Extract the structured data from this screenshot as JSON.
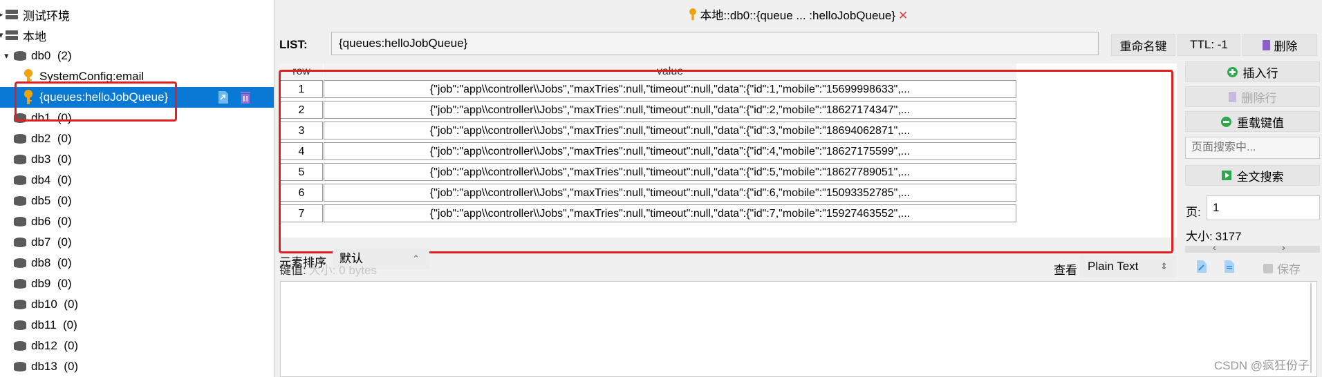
{
  "tree": {
    "items": [
      {
        "label": "测试环境",
        "type": "connection"
      },
      {
        "label": "本地",
        "type": "connection"
      },
      {
        "label": "db0",
        "count": "(2)",
        "type": "db"
      },
      {
        "label": "SystemConfig:email",
        "type": "key"
      },
      {
        "label": "{queues:helloJobQueue}",
        "type": "key"
      },
      {
        "label": "db1",
        "count": "(0)",
        "type": "db"
      },
      {
        "label": "db2",
        "count": "(0)",
        "type": "db"
      },
      {
        "label": "db3",
        "count": "(0)",
        "type": "db"
      },
      {
        "label": "db4",
        "count": "(0)",
        "type": "db"
      },
      {
        "label": "db5",
        "count": "(0)",
        "type": "db"
      },
      {
        "label": "db6",
        "count": "(0)",
        "type": "db"
      },
      {
        "label": "db7",
        "count": "(0)",
        "type": "db"
      },
      {
        "label": "db8",
        "count": "(0)",
        "type": "db"
      },
      {
        "label": "db9",
        "count": "(0)",
        "type": "db"
      },
      {
        "label": "db10",
        "count": "(0)",
        "type": "db"
      },
      {
        "label": "db11",
        "count": "(0)",
        "type": "db"
      },
      {
        "label": "db12",
        "count": "(0)",
        "type": "db"
      },
      {
        "label": "db13",
        "count": "(0)",
        "type": "db"
      }
    ]
  },
  "tab": {
    "title": "本地::db0::{queue ... :helloJobQueue}",
    "close": "✕"
  },
  "key": {
    "type_label": "LIST:",
    "name": "{queues:helloJobQueue}",
    "rename": "重命名键",
    "ttl": "TTL:  -1",
    "delete": "删除"
  },
  "table": {
    "columns": [
      "row",
      "value"
    ],
    "rows": [
      {
        "row": "1",
        "value": "{\"job\":\"app\\\\controller\\\\Jobs\",\"maxTries\":null,\"timeout\":null,\"data\":{\"id\":1,\"mobile\":\"15699998633\",..."
      },
      {
        "row": "2",
        "value": "{\"job\":\"app\\\\controller\\\\Jobs\",\"maxTries\":null,\"timeout\":null,\"data\":{\"id\":2,\"mobile\":\"18627174347\",..."
      },
      {
        "row": "3",
        "value": "{\"job\":\"app\\\\controller\\\\Jobs\",\"maxTries\":null,\"timeout\":null,\"data\":{\"id\":3,\"mobile\":\"18694062871\",..."
      },
      {
        "row": "4",
        "value": "{\"job\":\"app\\\\controller\\\\Jobs\",\"maxTries\":null,\"timeout\":null,\"data\":{\"id\":4,\"mobile\":\"18627175599\",..."
      },
      {
        "row": "5",
        "value": "{\"job\":\"app\\\\controller\\\\Jobs\",\"maxTries\":null,\"timeout\":null,\"data\":{\"id\":5,\"mobile\":\"18627789051\",..."
      },
      {
        "row": "6",
        "value": "{\"job\":\"app\\\\controller\\\\Jobs\",\"maxTries\":null,\"timeout\":null,\"data\":{\"id\":6,\"mobile\":\"15093352785\",..."
      },
      {
        "row": "7",
        "value": "{\"job\":\"app\\\\controller\\\\Jobs\",\"maxTries\":null,\"timeout\":null,\"data\":{\"id\":7,\"mobile\":\"15927463552\",..."
      }
    ]
  },
  "side": {
    "insert_row": "插入行",
    "delete_row": "删除行",
    "reload": "重载键值",
    "page_search_placeholder": "页面搜索中...",
    "full_search": "全文搜索",
    "page_label": "页:",
    "page_value": "1",
    "size_label": "大小:",
    "size_value": "3177"
  },
  "lower": {
    "sort_label": "元素排序",
    "sort_value": "默认",
    "keyval_label": "键值:",
    "keyval_size": "大小: 0 bytes",
    "view_label": "查看",
    "view_value": "Plain Text",
    "save": "保存"
  },
  "watermark": "CSDN @疯狂份子",
  "colors": {
    "selected": "#0a79d6",
    "highlight": "#e02020",
    "key_icon": "#f0a30a",
    "db_icon": "#5a5a5a"
  }
}
